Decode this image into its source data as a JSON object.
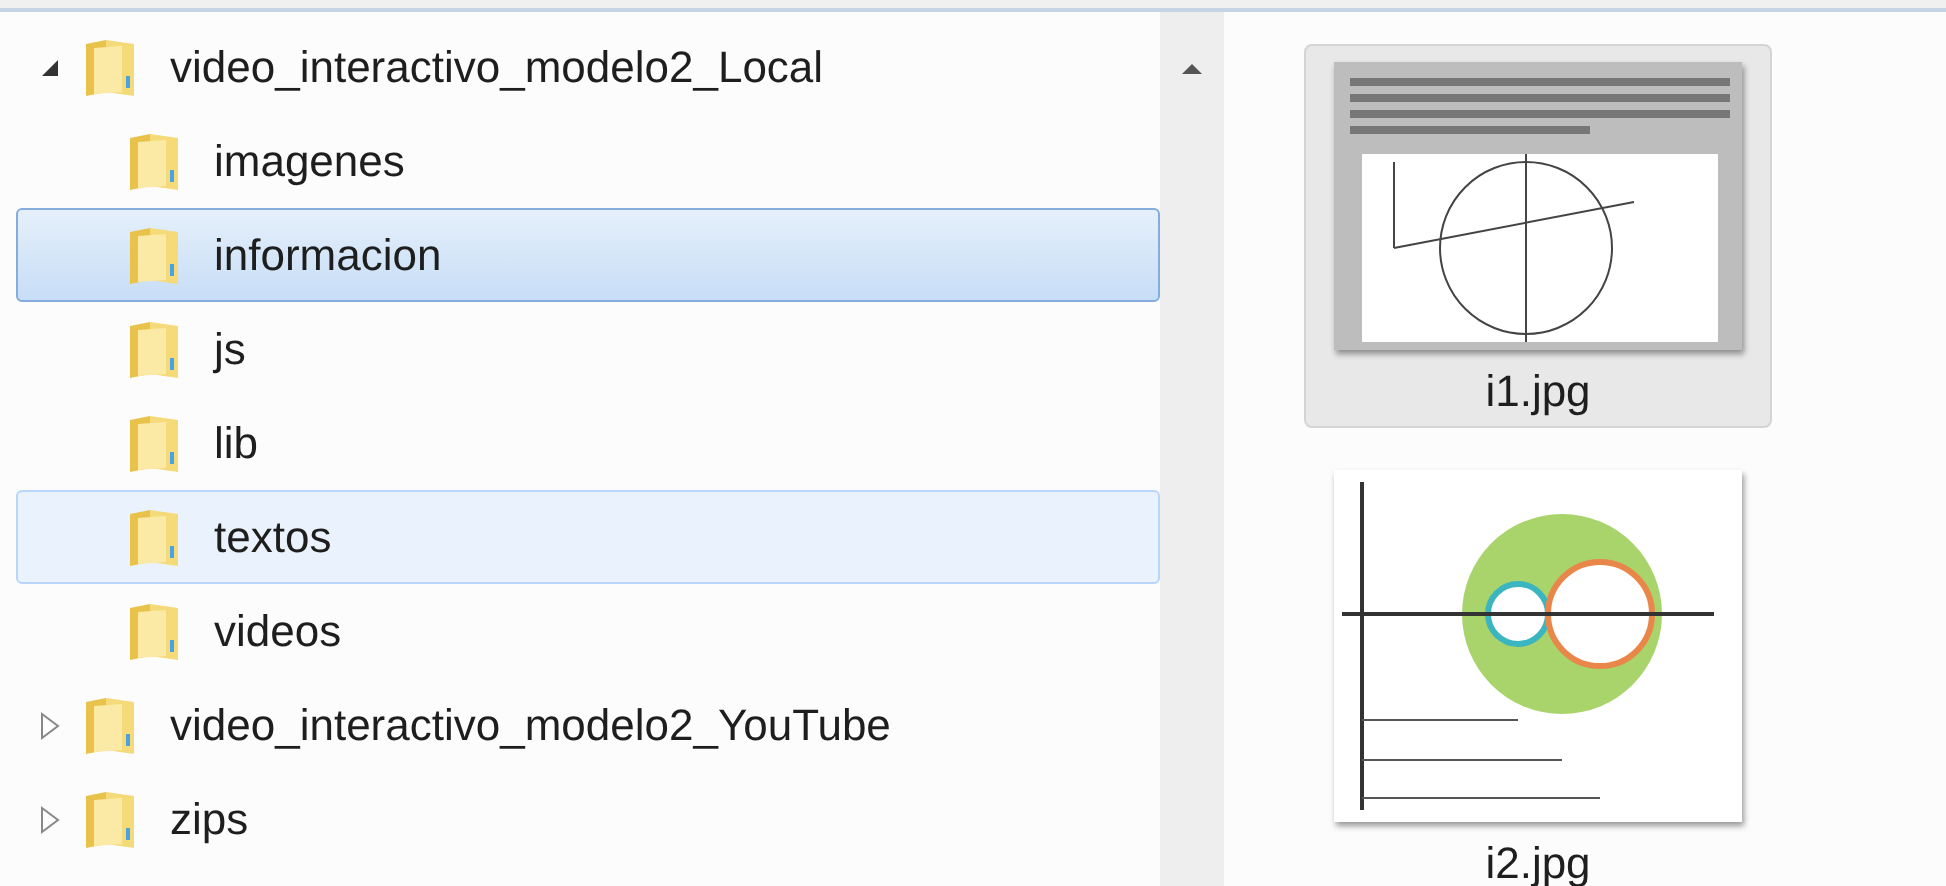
{
  "tree": [
    {
      "label": "video_interactivo_modelo2_Local",
      "expanded": true,
      "selected": false,
      "hovered": false,
      "children": [
        {
          "label": "imagenes",
          "selected": false,
          "hovered": false
        },
        {
          "label": "informacion",
          "selected": true,
          "hovered": false
        },
        {
          "label": "js",
          "selected": false,
          "hovered": false
        },
        {
          "label": "lib",
          "selected": false,
          "hovered": false
        },
        {
          "label": "textos",
          "selected": false,
          "hovered": true
        },
        {
          "label": "videos",
          "selected": false,
          "hovered": false
        }
      ]
    },
    {
      "label": "video_interactivo_modelo2_YouTube",
      "expanded": false,
      "selected": false,
      "hovered": false
    },
    {
      "label": "zips",
      "expanded": false,
      "selected": false,
      "hovered": false
    }
  ],
  "files": [
    {
      "name": "i1.jpg",
      "selected": true,
      "kind": "picture"
    },
    {
      "name": "i2.jpg",
      "selected": false,
      "kind": "picture"
    }
  ]
}
